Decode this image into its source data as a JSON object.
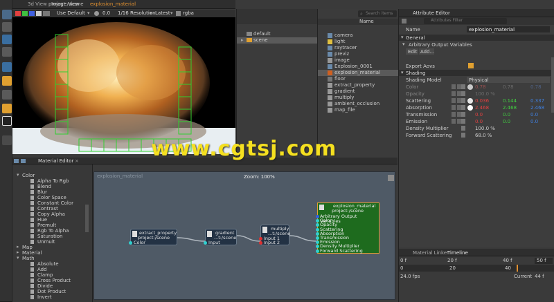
{
  "viewer": {
    "tab_3d": "3d View",
    "tab_image": "Image View",
    "breadcrumb": "project:/",
    "breadcrumb2": "scene",
    "material_path": "explosion_material",
    "display": "Use Default",
    "exposure": "0.0",
    "resolution": "1/16 Resolution",
    "version": "Latest",
    "channel": "rgba"
  },
  "scene_tree": {
    "items": [
      "default",
      "scene"
    ]
  },
  "outliner": {
    "search": "Search items",
    "col_name": "Name",
    "items": [
      "camera",
      "light",
      "raytracer",
      "previz",
      "image",
      "Explosion_0001",
      "explosion_material",
      "floor",
      "extract_property",
      "gradient",
      "multiply",
      "ambient_occlusion",
      "map_file"
    ]
  },
  "attr": {
    "title": "Attribute Editor",
    "filter": "Attributes Filter",
    "name_label": "Name",
    "name_value": "explosion_material",
    "general": "General",
    "aov_group": "Arbitrary Output Variables",
    "edit": "Edit",
    "add": "Add...",
    "export_aovs": "Export Aovs",
    "shading": "Shading",
    "shading_model_label": "Shading Model",
    "shading_model": "Physical",
    "rows": [
      {
        "label": "Color",
        "v1": "0.78",
        "v2": "0.78",
        "v3": "0.78",
        "c1": "#e06060",
        "c2": "#909090",
        "c3": "#6080c0",
        "dim": true,
        "sw": "#c8c8c8"
      },
      {
        "label": "Opacity",
        "v1": "100.0 %",
        "v2": "",
        "v3": "",
        "c1": "#909090",
        "c2": "",
        "c3": "",
        "dim": true,
        "sw": ""
      },
      {
        "label": "Scattering",
        "v1": "0.036",
        "v2": "0.144",
        "v3": "0.337",
        "c1": "#e04040",
        "c2": "#40d040",
        "c3": "#4080e0",
        "dim": false,
        "sw": "#e8e8e8"
      },
      {
        "label": "Absorption",
        "v1": "2.468",
        "v2": "2.468",
        "v3": "2.468",
        "c1": "#e04040",
        "c2": "#40d040",
        "c3": "#4080e0",
        "dim": false,
        "sw": "#ffffff"
      },
      {
        "label": "Transmission",
        "v1": "0.0",
        "v2": "0.0",
        "v3": "0.0",
        "c1": "#e04040",
        "c2": "#40d040",
        "c3": "#4080e0",
        "dim": false,
        "sw": ""
      },
      {
        "label": "Emission",
        "v1": "0.0",
        "v2": "0.0",
        "v3": "0.0",
        "c1": "#e04040",
        "c2": "#40d040",
        "c3": "#4080e0",
        "dim": false,
        "sw": ""
      },
      {
        "label": "Density Multiplier",
        "v1": "100.0 %",
        "v2": "",
        "v3": "",
        "c1": "#cfcfcf",
        "c2": "",
        "c3": "",
        "dim": false,
        "sw": ""
      },
      {
        "label": "Forward Scattering",
        "v1": "68.0 %",
        "v2": "",
        "v3": "",
        "c1": "#cfcfcf",
        "c2": "",
        "c3": "",
        "dim": false,
        "sw": ""
      }
    ]
  },
  "material_editor": {
    "title": "Material Editor",
    "canvas_label": "explosion_material",
    "zoom": "Zoom: 100%",
    "tree": [
      "Color",
      "Alpha To Rgb",
      "Blend",
      "Blur",
      "Color Space",
      "Constant Color",
      "Contrast",
      "Copy Alpha",
      "Hue",
      "Premult",
      "Rgb To Alpha",
      "Saturation",
      "Unmult",
      "Map",
      "Material",
      "Math",
      "Absolute",
      "Add",
      "Clamp",
      "Cross Product",
      "Divide",
      "Dot Product",
      "Invert"
    ],
    "nodes": {
      "extract": {
        "title": "extract_property",
        "sub": "project:/scene",
        "port": "Color"
      },
      "gradient": {
        "title": "gradient",
        "sub": "...t:/scene",
        "port": "Input"
      },
      "multiply": {
        "title": "multiply",
        "sub": "...t:/scene",
        "p1": "Input 1",
        "p2": "Input 2"
      },
      "material": {
        "title": "explosion_material",
        "sub": "project:/scene",
        "ports": [
          "Arbitrary Output Variables",
          "Color",
          "Opacity",
          "Scattering",
          "Absorption",
          "Transmission",
          "Emission",
          "Density Multiplier",
          "Forward Scattering"
        ]
      }
    }
  },
  "timeline": {
    "tab1": "Material Linker",
    "tab2": "Timeline",
    "start": "0 f",
    "t20": "20 f",
    "t40": "40 f",
    "end": "50 f",
    "ts0": "0",
    "ts20": "20",
    "ts40": "40",
    "fps": "24.0 fps",
    "current": "Current",
    "cur_val": "44 f"
  },
  "watermark": "www.cgtsj.com"
}
